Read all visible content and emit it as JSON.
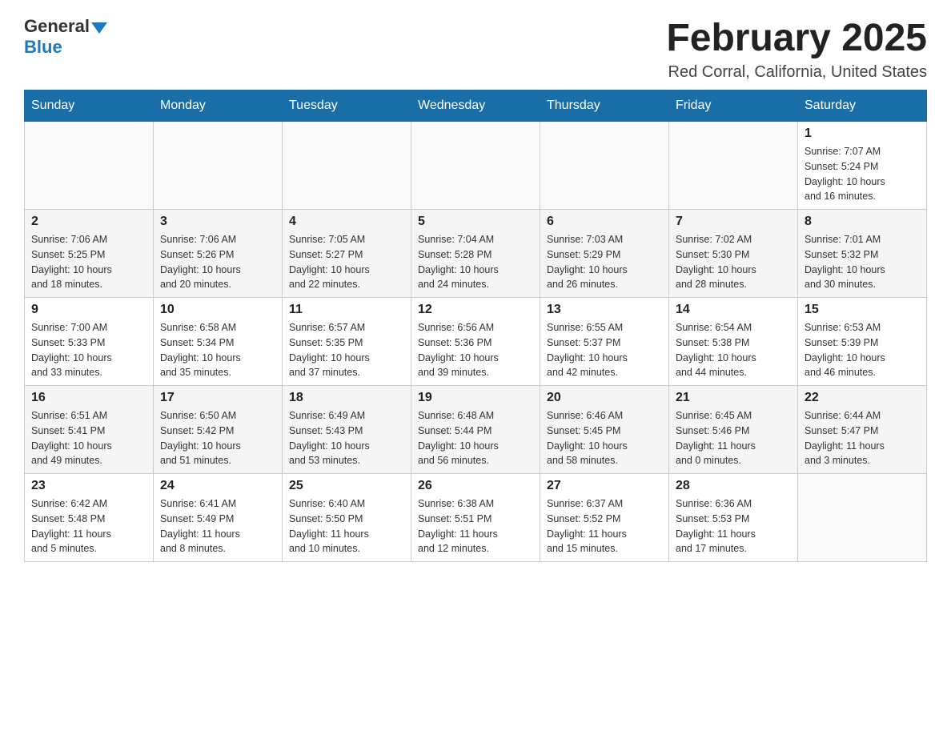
{
  "logo": {
    "general": "General",
    "blue": "Blue"
  },
  "title": "February 2025",
  "location": "Red Corral, California, United States",
  "weekdays": [
    "Sunday",
    "Monday",
    "Tuesday",
    "Wednesday",
    "Thursday",
    "Friday",
    "Saturday"
  ],
  "weeks": [
    [
      {
        "day": "",
        "info": ""
      },
      {
        "day": "",
        "info": ""
      },
      {
        "day": "",
        "info": ""
      },
      {
        "day": "",
        "info": ""
      },
      {
        "day": "",
        "info": ""
      },
      {
        "day": "",
        "info": ""
      },
      {
        "day": "1",
        "info": "Sunrise: 7:07 AM\nSunset: 5:24 PM\nDaylight: 10 hours\nand 16 minutes."
      }
    ],
    [
      {
        "day": "2",
        "info": "Sunrise: 7:06 AM\nSunset: 5:25 PM\nDaylight: 10 hours\nand 18 minutes."
      },
      {
        "day": "3",
        "info": "Sunrise: 7:06 AM\nSunset: 5:26 PM\nDaylight: 10 hours\nand 20 minutes."
      },
      {
        "day": "4",
        "info": "Sunrise: 7:05 AM\nSunset: 5:27 PM\nDaylight: 10 hours\nand 22 minutes."
      },
      {
        "day": "5",
        "info": "Sunrise: 7:04 AM\nSunset: 5:28 PM\nDaylight: 10 hours\nand 24 minutes."
      },
      {
        "day": "6",
        "info": "Sunrise: 7:03 AM\nSunset: 5:29 PM\nDaylight: 10 hours\nand 26 minutes."
      },
      {
        "day": "7",
        "info": "Sunrise: 7:02 AM\nSunset: 5:30 PM\nDaylight: 10 hours\nand 28 minutes."
      },
      {
        "day": "8",
        "info": "Sunrise: 7:01 AM\nSunset: 5:32 PM\nDaylight: 10 hours\nand 30 minutes."
      }
    ],
    [
      {
        "day": "9",
        "info": "Sunrise: 7:00 AM\nSunset: 5:33 PM\nDaylight: 10 hours\nand 33 minutes."
      },
      {
        "day": "10",
        "info": "Sunrise: 6:58 AM\nSunset: 5:34 PM\nDaylight: 10 hours\nand 35 minutes."
      },
      {
        "day": "11",
        "info": "Sunrise: 6:57 AM\nSunset: 5:35 PM\nDaylight: 10 hours\nand 37 minutes."
      },
      {
        "day": "12",
        "info": "Sunrise: 6:56 AM\nSunset: 5:36 PM\nDaylight: 10 hours\nand 39 minutes."
      },
      {
        "day": "13",
        "info": "Sunrise: 6:55 AM\nSunset: 5:37 PM\nDaylight: 10 hours\nand 42 minutes."
      },
      {
        "day": "14",
        "info": "Sunrise: 6:54 AM\nSunset: 5:38 PM\nDaylight: 10 hours\nand 44 minutes."
      },
      {
        "day": "15",
        "info": "Sunrise: 6:53 AM\nSunset: 5:39 PM\nDaylight: 10 hours\nand 46 minutes."
      }
    ],
    [
      {
        "day": "16",
        "info": "Sunrise: 6:51 AM\nSunset: 5:41 PM\nDaylight: 10 hours\nand 49 minutes."
      },
      {
        "day": "17",
        "info": "Sunrise: 6:50 AM\nSunset: 5:42 PM\nDaylight: 10 hours\nand 51 minutes."
      },
      {
        "day": "18",
        "info": "Sunrise: 6:49 AM\nSunset: 5:43 PM\nDaylight: 10 hours\nand 53 minutes."
      },
      {
        "day": "19",
        "info": "Sunrise: 6:48 AM\nSunset: 5:44 PM\nDaylight: 10 hours\nand 56 minutes."
      },
      {
        "day": "20",
        "info": "Sunrise: 6:46 AM\nSunset: 5:45 PM\nDaylight: 10 hours\nand 58 minutes."
      },
      {
        "day": "21",
        "info": "Sunrise: 6:45 AM\nSunset: 5:46 PM\nDaylight: 11 hours\nand 0 minutes."
      },
      {
        "day": "22",
        "info": "Sunrise: 6:44 AM\nSunset: 5:47 PM\nDaylight: 11 hours\nand 3 minutes."
      }
    ],
    [
      {
        "day": "23",
        "info": "Sunrise: 6:42 AM\nSunset: 5:48 PM\nDaylight: 11 hours\nand 5 minutes."
      },
      {
        "day": "24",
        "info": "Sunrise: 6:41 AM\nSunset: 5:49 PM\nDaylight: 11 hours\nand 8 minutes."
      },
      {
        "day": "25",
        "info": "Sunrise: 6:40 AM\nSunset: 5:50 PM\nDaylight: 11 hours\nand 10 minutes."
      },
      {
        "day": "26",
        "info": "Sunrise: 6:38 AM\nSunset: 5:51 PM\nDaylight: 11 hours\nand 12 minutes."
      },
      {
        "day": "27",
        "info": "Sunrise: 6:37 AM\nSunset: 5:52 PM\nDaylight: 11 hours\nand 15 minutes."
      },
      {
        "day": "28",
        "info": "Sunrise: 6:36 AM\nSunset: 5:53 PM\nDaylight: 11 hours\nand 17 minutes."
      },
      {
        "day": "",
        "info": ""
      }
    ]
  ]
}
